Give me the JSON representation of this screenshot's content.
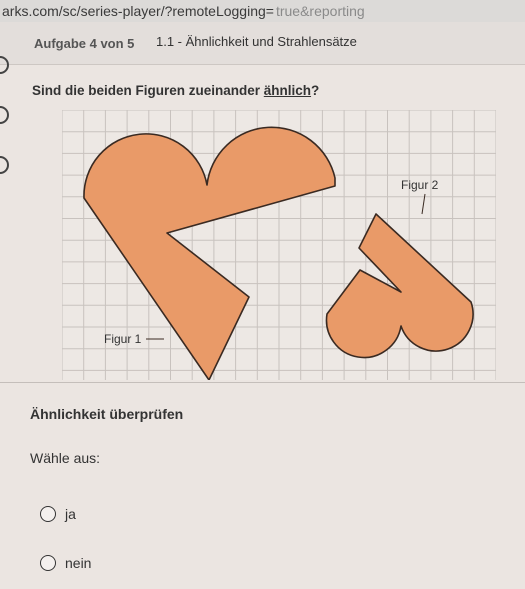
{
  "browser": {
    "url": "arks.com/sc/series-player/?remoteLogging=",
    "url_faded": "true&reporting"
  },
  "header": {
    "task_counter": "Aufgabe 4 von 5",
    "task_title": "1.1 - Ähnlichkeit und Strahlensätze"
  },
  "question": {
    "before": "Sind die beiden Figuren zueinander ",
    "keyword": "ähnlich",
    "after": "?"
  },
  "figure": {
    "label_1": "Figur 1",
    "label_2": "Figur 2",
    "fill_color": "#e99a68",
    "stroke_color": "#3a2a22",
    "grid_color": "#c8c2be"
  },
  "check": {
    "title": "Ähnlichkeit überprüfen",
    "choose_label": "Wähle aus:",
    "options": [
      {
        "label": "ja"
      },
      {
        "label": "nein"
      }
    ]
  }
}
